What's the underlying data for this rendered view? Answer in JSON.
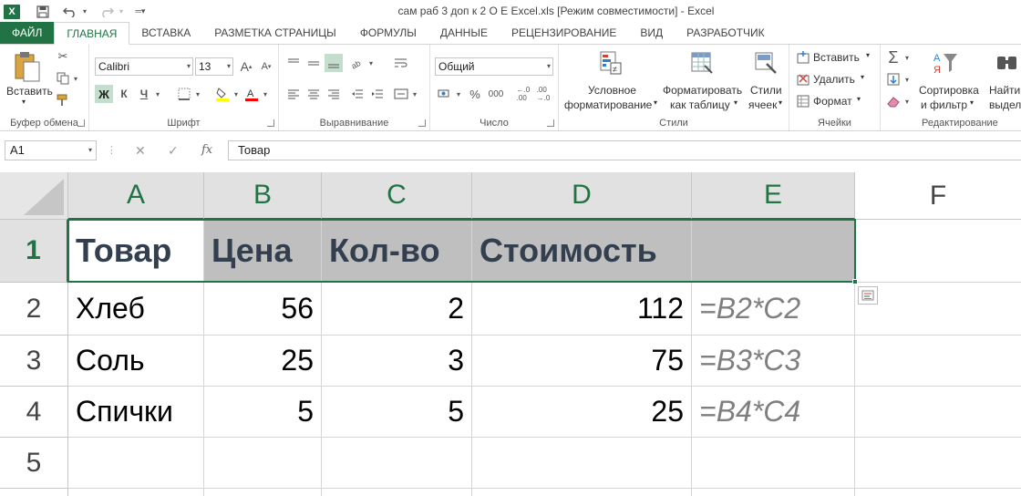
{
  "window": {
    "title": "сам раб 3 доп к 2 О Е  Excel.xls  [Режим совместимости] - Excel"
  },
  "qat": {
    "logo": "X",
    "save_icon": "save-icon",
    "undo_icon": "undo-icon",
    "redo_icon": "redo-icon"
  },
  "tabs": [
    {
      "label": "ФАЙЛ"
    },
    {
      "label": "ГЛАВНАЯ"
    },
    {
      "label": "ВСТАВКА"
    },
    {
      "label": "РАЗМЕТКА СТРАНИЦЫ"
    },
    {
      "label": "ФОРМУЛЫ"
    },
    {
      "label": "ДАННЫЕ"
    },
    {
      "label": "РЕЦЕНЗИРОВАНИЕ"
    },
    {
      "label": "ВИД"
    },
    {
      "label": "РАЗРАБОТЧИК"
    }
  ],
  "ribbon": {
    "clipboard": {
      "label": "Буфер обмена",
      "paste": "Вставить"
    },
    "font": {
      "label": "Шрифт",
      "font_name": "Calibri",
      "font_size": "13",
      "bold": "Ж",
      "italic": "К",
      "underline": "Ч",
      "grow": "A",
      "shrink": "A"
    },
    "alignment": {
      "label": "Выравнивание"
    },
    "number": {
      "label": "Число",
      "format": "Общий",
      "percent": "%",
      "thousands": "000"
    },
    "styles": {
      "label": "Стили",
      "conditional_1": "Условное",
      "conditional_2": "форматирование",
      "table_1": "Форматировать",
      "table_2": "как таблицу",
      "cell_1": "Стили",
      "cell_2": "ячеек"
    },
    "cells": {
      "label": "Ячейки",
      "insert": "Вставить",
      "delete": "Удалить",
      "format": "Формат"
    },
    "editing": {
      "label": "Редактирование",
      "sort_1": "Сортировка",
      "sort_2": "и фильтр",
      "find_1": "Найти",
      "find_2": "выдели"
    }
  },
  "formula_bar": {
    "name_box": "A1",
    "content": "Товар",
    "fx": "fx"
  },
  "sheet": {
    "columns": [
      "A",
      "B",
      "C",
      "D",
      "E",
      "F"
    ],
    "rows": [
      "1",
      "2",
      "3",
      "4",
      "5"
    ],
    "cells": {
      "A1": "Товар",
      "B1": "Цена",
      "C1": "Кол-во",
      "D1": "Стоимость",
      "A2": "Хлеб",
      "B2": "56",
      "C2": "2",
      "D2": "112",
      "E2": "=B2*C2",
      "A3": "Соль",
      "B3": "25",
      "C3": "3",
      "D3": "75",
      "E3": "=B3*C3",
      "A4": "Спички",
      "B4": "5",
      "C4": "5",
      "D4": "25",
      "E4": "=B4*C4"
    }
  },
  "colors": {
    "accent": "#217346",
    "header_fill": "#bfbfbf",
    "header_text": "#333f4f",
    "formula_text": "#7f7f7f"
  }
}
